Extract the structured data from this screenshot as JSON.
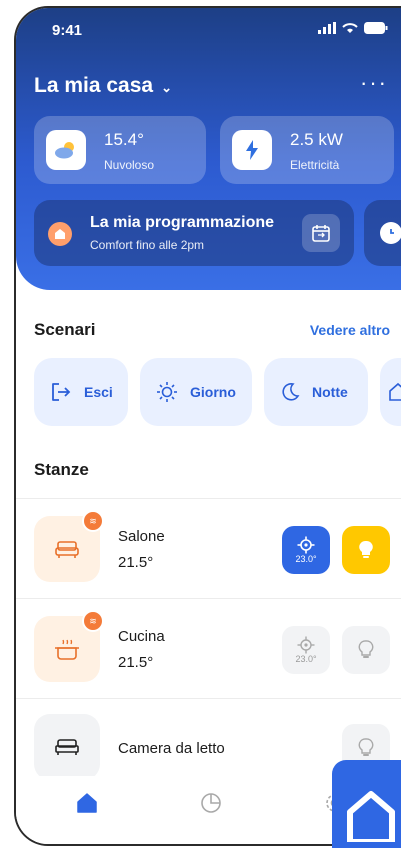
{
  "status": {
    "time": "9:41"
  },
  "header": {
    "home_title": "La mia casa"
  },
  "cards": {
    "weather": {
      "value": "15.4°",
      "label": "Nuvoloso"
    },
    "power": {
      "value": "2.5 kW",
      "label": "Elettricità"
    }
  },
  "schedule": {
    "title": "La mia programmazione",
    "subtitle": "Comfort fino alle 2pm"
  },
  "scenes": {
    "title": "Scenari",
    "see_more": "Vedere altro",
    "items": [
      {
        "label": "Esci",
        "icon": "exit-icon"
      },
      {
        "label": "Giorno",
        "icon": "sun-icon"
      },
      {
        "label": "Notte",
        "icon": "moon-icon"
      }
    ]
  },
  "rooms": {
    "title": "Stanze",
    "items": [
      {
        "name": "Salone",
        "temp": "21.5°",
        "thermo": "23.0°",
        "thermo_active": true,
        "light_on": true
      },
      {
        "name": "Cucina",
        "temp": "21.5°",
        "thermo": "23.0°",
        "thermo_active": false,
        "light_on": false
      },
      {
        "name": "Camera da letto",
        "temp": "",
        "thermo": "",
        "light_on": false
      }
    ]
  },
  "colors": {
    "accent": "#2f6fdf",
    "light_on": "#ffc800",
    "badge": "#f47b39"
  }
}
